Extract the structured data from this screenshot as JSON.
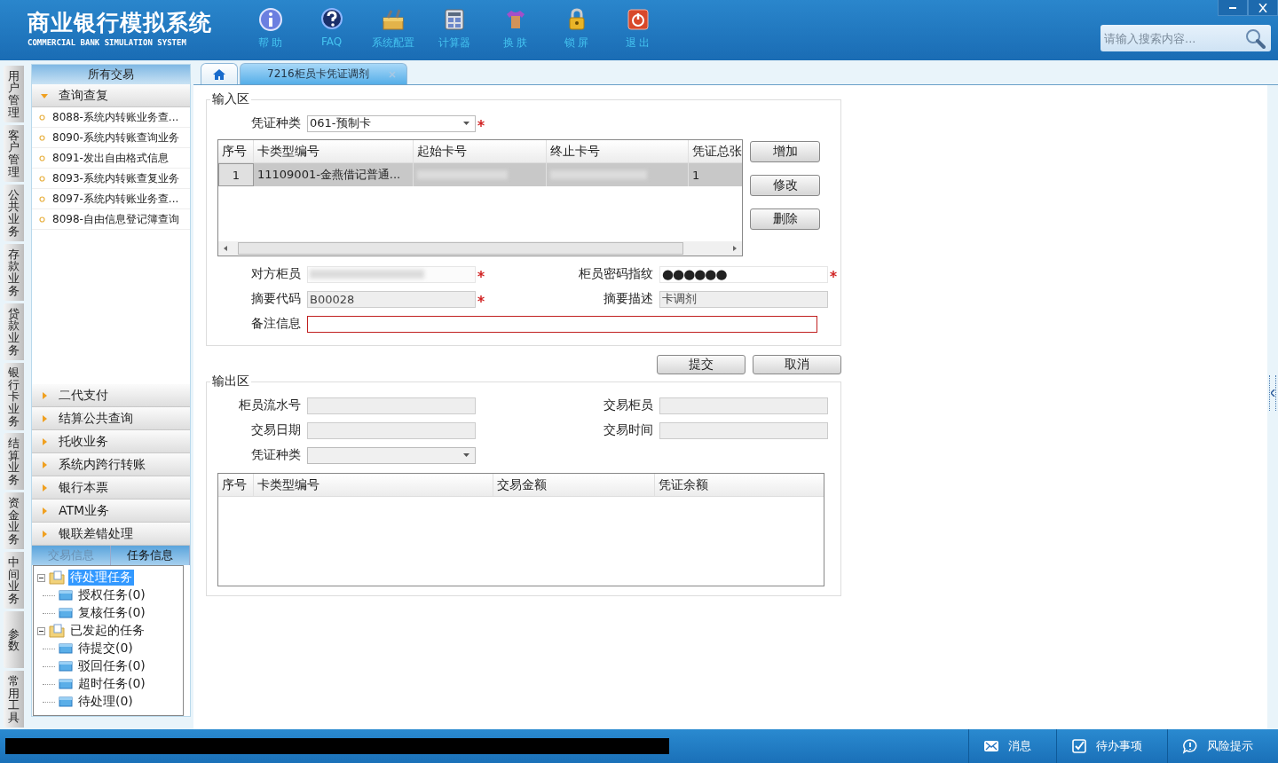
{
  "window": {
    "title": "商业银行模拟系统",
    "subtitle": "COMMERCIAL BANK SIMULATION SYSTEM"
  },
  "toolbar": [
    {
      "label": "帮 助",
      "kind": "info"
    },
    {
      "label": "FAQ",
      "kind": "faq"
    },
    {
      "label": "系统配置",
      "kind": "config"
    },
    {
      "label": "计算器",
      "kind": "calculator"
    },
    {
      "label": "换 肤",
      "kind": "skin"
    },
    {
      "label": "锁 屏",
      "kind": "lock"
    },
    {
      "label": "退 出",
      "kind": "exit"
    }
  ],
  "search": {
    "placeholder": "请输入搜索内容..."
  },
  "side_tabs": [
    "用户管理",
    "客户管理",
    "公共业务",
    "存款业务",
    "贷款业务",
    "银行卡业务",
    "结算业务",
    "资金业务",
    "中间业务",
    "参数",
    "常用工具"
  ],
  "nav": {
    "title": "所有交易",
    "groups": [
      {
        "label": "查询查复",
        "expanded": true,
        "items": [
          "8088-系统内转账业务查...",
          "8090-系统内转账查询业务",
          "8091-发出自由格式信息",
          "8093-系统内转账查复业务",
          "8097-系统内转账业务查...",
          "8098-自由信息登记簿查询"
        ]
      },
      {
        "label": "二代支付",
        "expanded": false
      },
      {
        "label": "结算公共查询",
        "expanded": false
      },
      {
        "label": "托收业务",
        "expanded": false
      },
      {
        "label": "系统内跨行转账",
        "expanded": false
      },
      {
        "label": "银行本票",
        "expanded": false
      },
      {
        "label": "ATM业务",
        "expanded": false
      },
      {
        "label": "银联差错处理",
        "expanded": false
      }
    ]
  },
  "task_panel": {
    "tabs": [
      {
        "label": "交易信息",
        "selected": false
      },
      {
        "label": "任务信息",
        "selected": true
      }
    ],
    "tree": [
      {
        "label": "待处理任务",
        "selected": true,
        "expanded": true,
        "children": [
          {
            "label": "授权任务(0)",
            "selected": false
          },
          {
            "label": "复核任务(0)",
            "selected": false
          }
        ]
      },
      {
        "label": "已发起的任务",
        "selected": false,
        "expanded": true,
        "children": [
          {
            "label": "待提交(0)",
            "selected": false
          },
          {
            "label": "驳回任务(0)",
            "selected": false
          },
          {
            "label": "超时任务(0)",
            "selected": false
          },
          {
            "label": "待处理(0)",
            "selected": false
          }
        ]
      }
    ]
  },
  "doc_tabs": [
    {
      "kind": "home",
      "selected": false
    },
    {
      "kind": "page",
      "label": "7216柜员卡凭证调剂",
      "selected": true
    }
  ],
  "input_area": {
    "title": "输入区",
    "voucher_type": {
      "label": "凭证种类",
      "value": "061-预制卡",
      "required": true
    },
    "grid": {
      "columns": [
        "序号",
        "卡类型编号",
        "起始卡号",
        "终止卡号",
        "凭证总张"
      ],
      "rows": [
        {
          "selected": true,
          "cells": [
            {
              "kind": "text",
              "text": "1"
            },
            {
              "kind": "text",
              "text": "11109001-金燕借记普通..."
            },
            {
              "kind": "blurred"
            },
            {
              "kind": "blurred"
            },
            {
              "kind": "text",
              "text": "1"
            }
          ]
        }
      ]
    },
    "grid_buttons": [
      "增加",
      "修改",
      "删除"
    ],
    "rows": [
      [
        {
          "label": "对方柜员",
          "kind": "blurred",
          "required": true
        },
        {
          "label": "柜员密码指纹",
          "kind": "password",
          "value": "●●●●●●",
          "required": true
        }
      ],
      [
        {
          "label": "摘要代码",
          "kind": "readonly",
          "value": "B00028",
          "required": true
        },
        {
          "label": "摘要描述",
          "kind": "readonly",
          "value": "卡调剂",
          "required": false
        }
      ],
      [
        {
          "label": "备注信息",
          "kind": "text",
          "wide": true,
          "error": true,
          "required": false
        }
      ]
    ]
  },
  "actions": [
    "提交",
    "取消"
  ],
  "output_area": {
    "title": "输出区",
    "rows": [
      [
        {
          "label": "柜员流水号",
          "kind": "readonly"
        },
        {
          "label": "交易柜员",
          "kind": "readonly"
        }
      ],
      [
        {
          "label": "交易日期",
          "kind": "readonly"
        },
        {
          "label": "交易时间",
          "kind": "readonly"
        }
      ],
      [
        {
          "label": "凭证种类",
          "kind": "select"
        }
      ]
    ],
    "grid": {
      "columns": [
        "序号",
        "卡类型编号",
        "交易金额",
        "凭证余额"
      ]
    }
  },
  "status_bar": [
    {
      "label": "消息",
      "kind": "mail"
    },
    {
      "label": "待办事项",
      "kind": "todo"
    },
    {
      "label": "风险提示",
      "kind": "alert"
    }
  ]
}
